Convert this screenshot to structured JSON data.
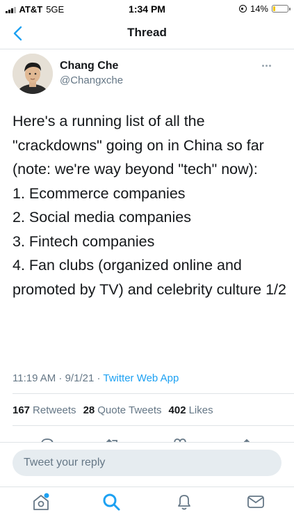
{
  "status_bar": {
    "carrier": "AT&T",
    "network": "5GE",
    "time": "1:34 PM",
    "battery": "14%",
    "battery_level": 0.14
  },
  "nav": {
    "back_icon": "chevron-left-icon",
    "title": "Thread"
  },
  "tweet": {
    "author_name": "Chang Che",
    "author_handle": "@Changxche",
    "text": "Here's a running list of all the \"crackdowns\" going on in China so far (note: we're way beyond \"tech\" now):\n1. Ecommerce companies\n2. Social media companies\n3. Fintech companies\n4. Fan clubs (organized online and promoted by TV) and celebrity culture 1/2",
    "timestamp": "11:19 AM · 9/1/21 · ",
    "source": "Twitter Web App"
  },
  "stats": {
    "retweets_count": "167",
    "retweets_label": "Retweets",
    "quotes_count": "28",
    "quotes_label": "Quote Tweets",
    "likes_count": "402",
    "likes_label": "Likes"
  },
  "actions": [
    "reply-icon",
    "retweet-icon",
    "like-icon",
    "share-icon"
  ],
  "reply": {
    "placeholder": "Tweet your reply"
  },
  "tabs": [
    "home-icon",
    "search-icon",
    "notifications-icon",
    "messages-icon"
  ],
  "colors": {
    "accent": "#1da1f2",
    "secondary_text": "#657786",
    "primary_text": "#14171a"
  }
}
